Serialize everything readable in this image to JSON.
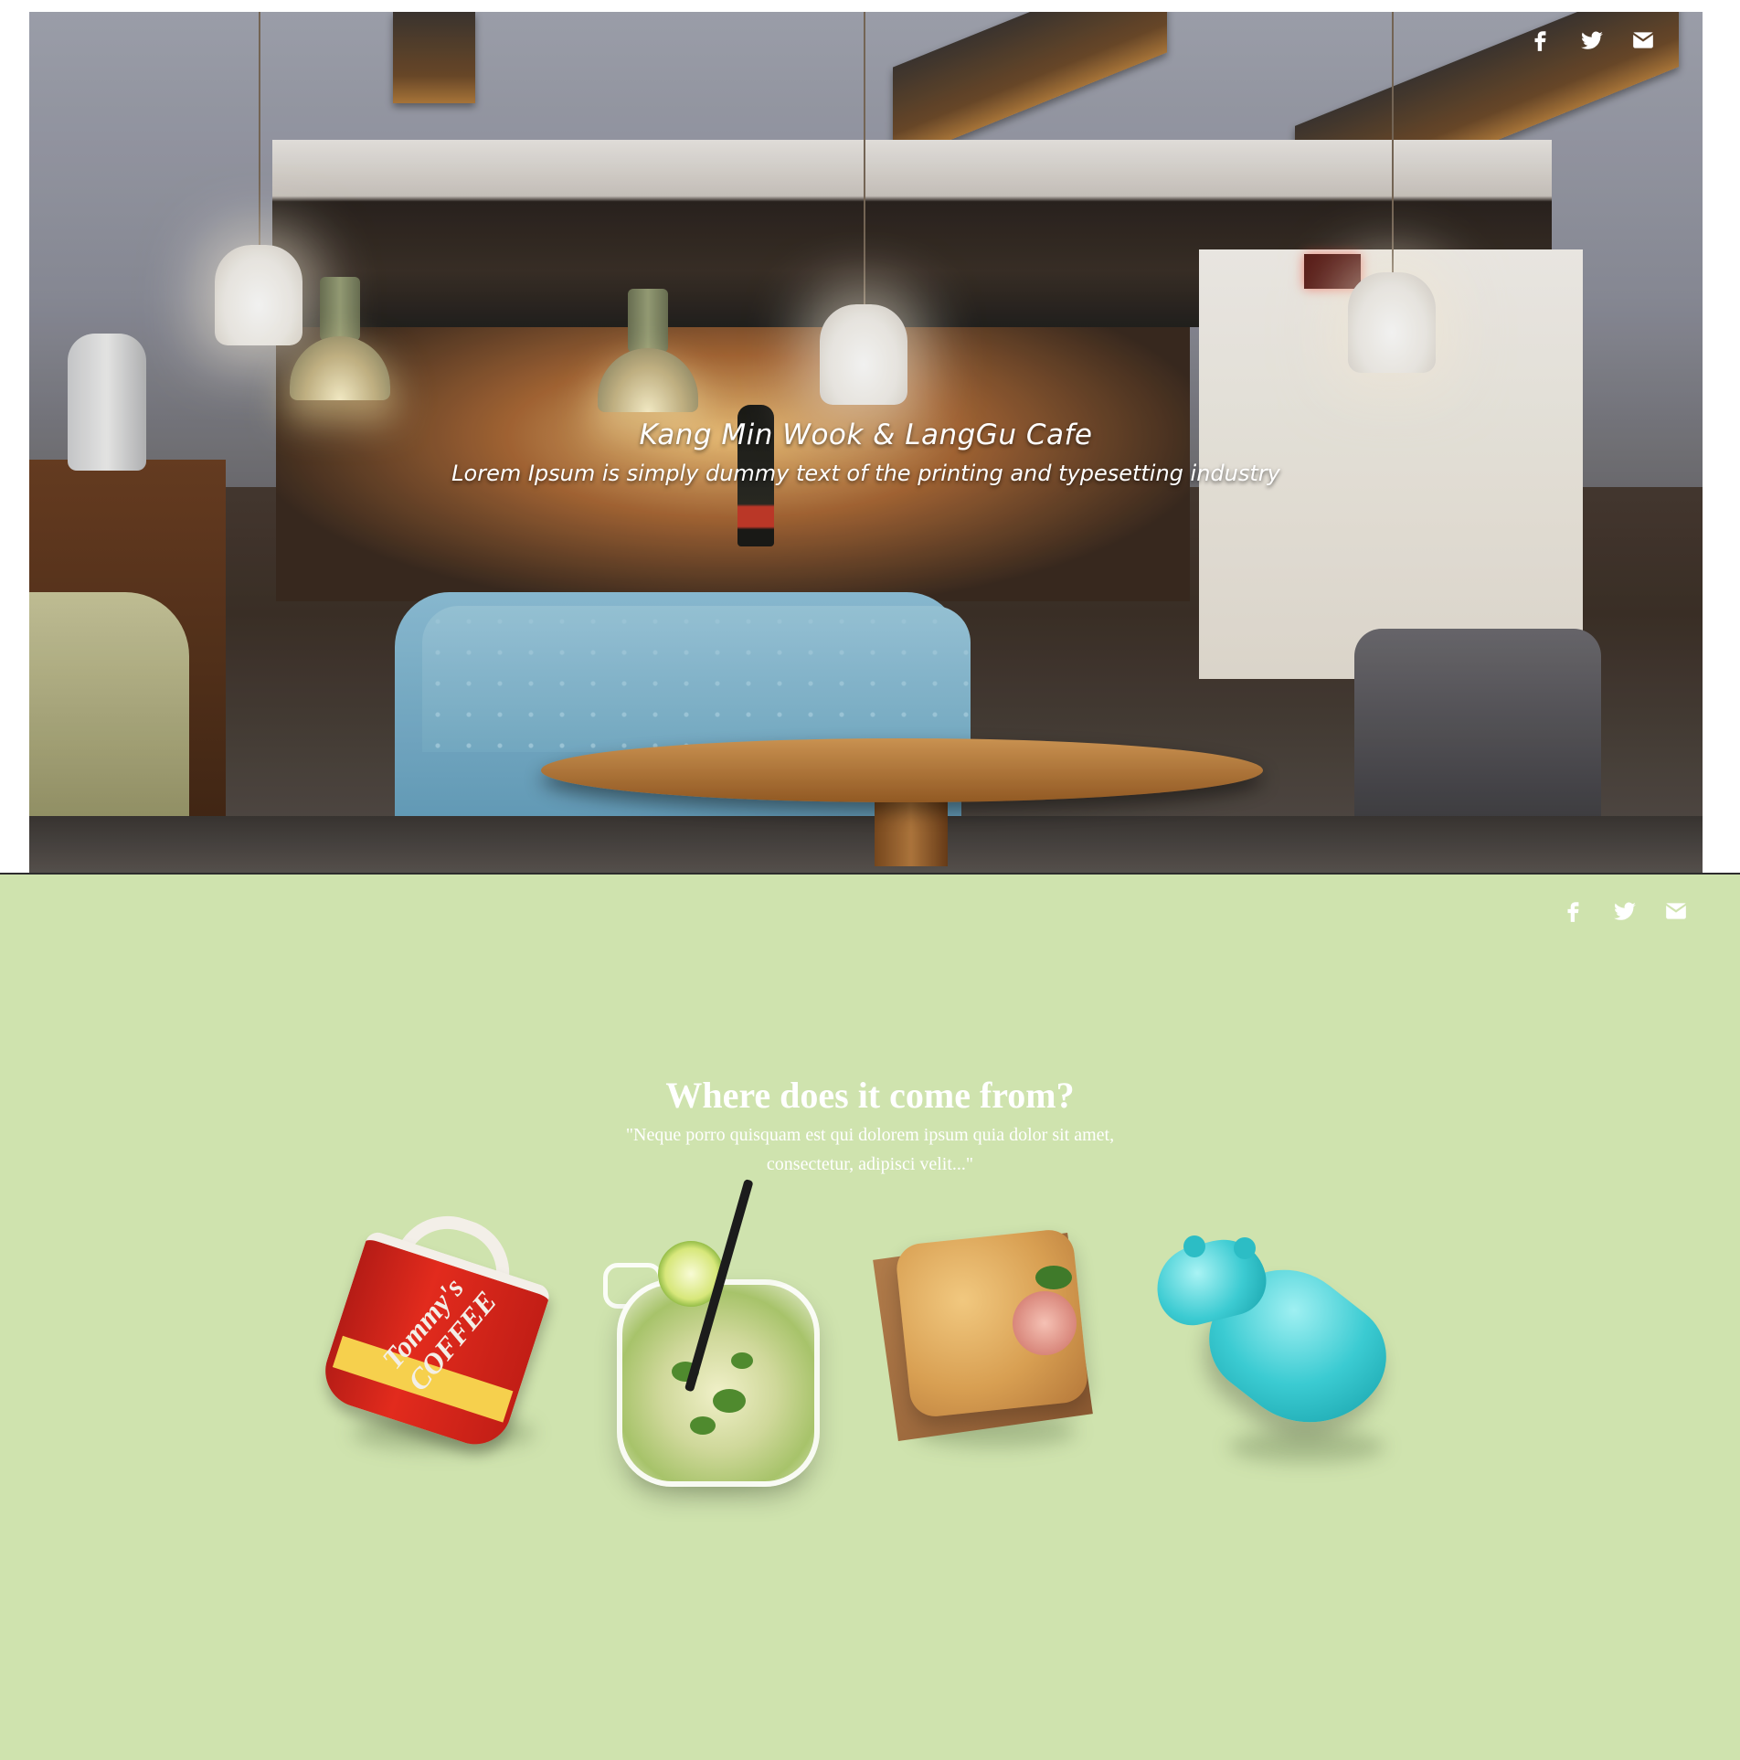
{
  "hero": {
    "title": "Kang Min Wook & LangGu Cafe",
    "subtitle": "Lorem Ipsum is simply dummy text of the printing and typesetting industry",
    "social": [
      {
        "icon": "facebook-icon",
        "label": "f"
      },
      {
        "icon": "twitter-icon",
        "label": "twitter"
      },
      {
        "icon": "envelope-icon",
        "label": "email"
      }
    ]
  },
  "section2": {
    "background_color": "#cfe3ae",
    "heading": "Where does it come from?",
    "quote": "\"Neque porro quisquam est qui dolorem ipsum quia dolor sit amet, consectetur, adipisci velit...\"",
    "social": [
      {
        "icon": "facebook-icon"
      },
      {
        "icon": "twitter-icon"
      },
      {
        "icon": "envelope-icon"
      }
    ],
    "products": [
      {
        "name": "coffee-mug",
        "text": "Tommy's COFFEE"
      },
      {
        "name": "mojito-jar"
      },
      {
        "name": "focaccia-sandwich"
      },
      {
        "name": "turquoise-hippo-figurine"
      }
    ]
  },
  "colors": {
    "text_on_image": "#ffffff",
    "section_background": "#cfe3ae"
  }
}
